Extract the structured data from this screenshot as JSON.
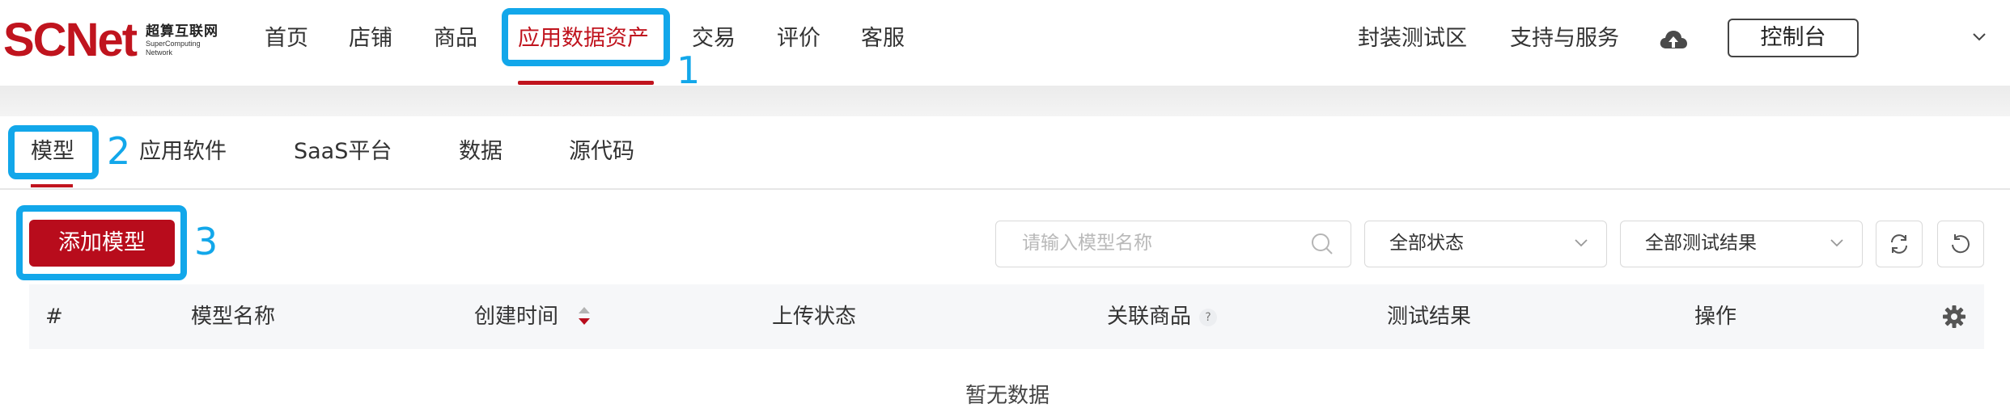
{
  "brand": {
    "logo": "SCNet",
    "name_cn": "超算互联网",
    "name_en_1": "SuperComputing",
    "name_en_2": "Network"
  },
  "nav": {
    "items": [
      "首页",
      "店铺",
      "商品",
      "应用数据资产",
      "交易",
      "评价",
      "客服"
    ],
    "active": "应用数据资产"
  },
  "nav_right": {
    "links": [
      "封装测试区",
      "支持与服务"
    ],
    "console_label": "控制台"
  },
  "tabs": {
    "items": [
      "模型",
      "应用软件",
      "SaaS平台",
      "数据",
      "源代码"
    ],
    "active": "模型"
  },
  "toolbar": {
    "add_label": "添加模型",
    "search_placeholder": "请输入模型名称",
    "status_select": "全部状态",
    "result_select": "全部测试结果"
  },
  "table": {
    "columns": [
      "#",
      "模型名称",
      "创建时间",
      "上传状态",
      "关联商品",
      "测试结果",
      "操作"
    ],
    "help_mark": "?",
    "rows": [],
    "empty_text": "暂无数据"
  },
  "callouts": [
    "1",
    "2",
    "3"
  ],
  "colors": {
    "brand_red": "#c0141e",
    "button_red": "#b80c1c",
    "callout_blue": "#12a7ea",
    "header_bg": "#f6f7f9"
  }
}
